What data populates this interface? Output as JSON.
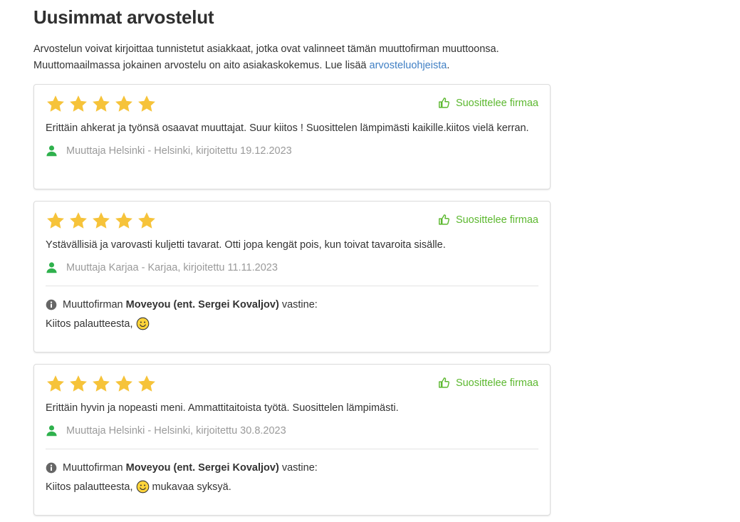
{
  "section": {
    "title": "Uusimmat arvostelut",
    "intro_line1": "Arvostelun voivat kirjoittaa tunnistetut asiakkaat, jotka ovat valinneet tämän muuttofirman muuttoonsa.",
    "intro_line2_prefix": "Muuttomaailmassa jokainen arvostelu on aito asiakaskokemus. Lue lisää ",
    "intro_link": "arvosteluohjeista",
    "intro_line2_suffix": "."
  },
  "colors": {
    "star": "#f6c33a",
    "recommend_green": "#5cb82f",
    "user_green": "#2fb14d",
    "link_blue": "#3f7fc4",
    "muted_text": "#9a9a9a"
  },
  "reviews": [
    {
      "rating": 5,
      "recommend_label": "Suosittelee firmaa",
      "text": "Erittäin ahkerat ja työnsä osaavat muuttajat. Suur kiitos ! Suosittelen lämpimästi kaikille.kiitos vielä kerran.",
      "author": "Muuttaja Helsinki - Helsinki, kirjoitettu 19.12.2023"
    },
    {
      "rating": 5,
      "recommend_label": "Suosittelee firmaa",
      "text": "Ystävällisiä ja varovasti kuljetti tavarat. Otti jopa kengät pois, kun toivat tavaroita sisälle.",
      "author": "Muuttaja Karjaa - Karjaa, kirjoitettu 11.11.2023",
      "reply_prefix": "Muuttofirman ",
      "reply_company": "Moveyou (ent. Sergei Kovaljov)",
      "reply_suffix": " vastine:",
      "reply_text": "Kiitos palautteesta,",
      "reply_text_after": ""
    },
    {
      "rating": 5,
      "recommend_label": "Suosittelee firmaa",
      "text": "Erittäin hyvin ja nopeasti meni. Ammattitaitoista työtä. Suosittelen lämpimästi.",
      "author": "Muuttaja Helsinki - Helsinki, kirjoitettu 30.8.2023",
      "reply_prefix": "Muuttofirman ",
      "reply_company": "Moveyou (ent. Sergei Kovaljov)",
      "reply_suffix": " vastine:",
      "reply_text": "Kiitos palautteesta,",
      "reply_text_after": "mukavaa syksyä."
    }
  ]
}
